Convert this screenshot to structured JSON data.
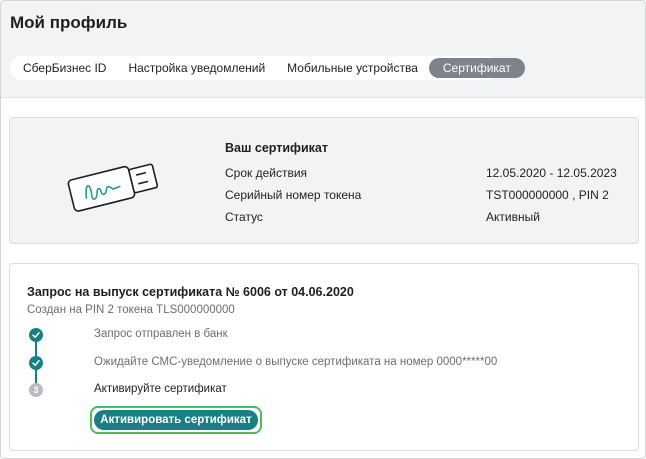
{
  "header": {
    "title": "Мой профиль"
  },
  "tabs": [
    {
      "label": "СберБизнес ID"
    },
    {
      "label": "Настройка уведомлений"
    },
    {
      "label": "Мобильные устройства"
    },
    {
      "label": "Сертификат"
    }
  ],
  "certificate": {
    "title": "Ваш сертификат",
    "rows": [
      {
        "label": "Срок действия",
        "value": "12.05.2020 - 12.05.2023"
      },
      {
        "label": "Серийный номер токена",
        "value": "TST000000000 , PIN 2"
      },
      {
        "label": "Статус",
        "value": "Активный"
      }
    ]
  },
  "request": {
    "title": "Запрос на выпуск сертификата № 6006 от 04.06.2020",
    "subtitle": "Создан на PIN 2 токена TLS000000000",
    "steps": [
      {
        "text": "Запрос отправлен в банк"
      },
      {
        "text": "Ожидайте СМС-уведомление о выпуске сертификата на номер 0000*****00"
      },
      {
        "number": "3",
        "text": "Активируйте сертификат"
      }
    ],
    "button_label": "Активировать сертификат"
  },
  "colors": {
    "accent": "#1a7f84",
    "focus": "#4cbc5e",
    "active_tab": "#7d838a"
  }
}
